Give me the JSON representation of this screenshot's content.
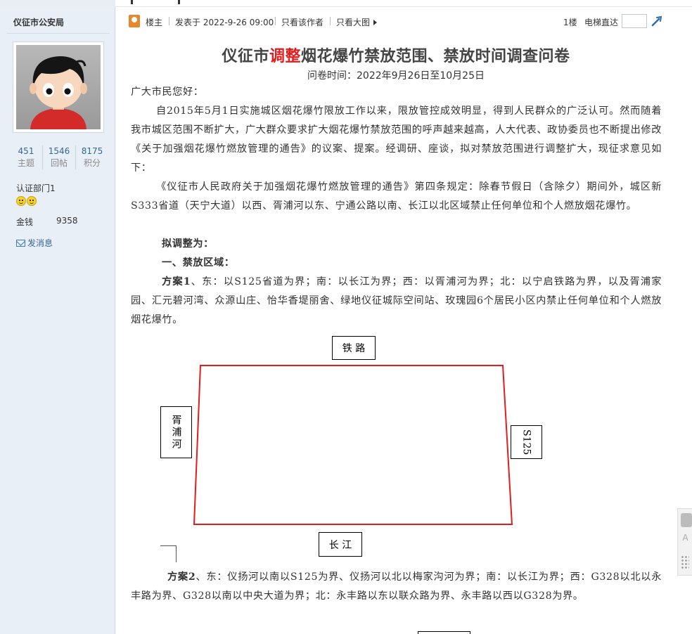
{
  "user": {
    "name": "仪征市公安局",
    "stats": [
      {
        "value": "451",
        "label": "主题"
      },
      {
        "value": "1546",
        "label": "回帖"
      },
      {
        "value": "8175",
        "label": "积分"
      }
    ],
    "certification": "认证部门1",
    "money_label": "金钱",
    "money_value": "9358",
    "message_link": "发消息"
  },
  "post_header": {
    "role": "楼主",
    "posted_at": "发表于 2022-9-26 09:00",
    "only_author": "只看该作者",
    "big_image": "只看大图",
    "floor": "1楼",
    "elevator": "电梯直达"
  },
  "article": {
    "title_pre": "仪征市",
    "title_red": "调整",
    "title_post": "烟花爆竹禁放范围、禁放时间调查问卷",
    "subtitle": "问卷时间：2022年9月26日至10月25日",
    "greeting": "广大市民您好：",
    "p1": "自2015年5月1日实施城区烟花爆竹限放工作以来，限放管控成效明显，得到人民群众的广泛认可。然而随着我市城区范围不断扩大，广大群众要求扩大烟花爆竹禁放范围的呼声越来越高，人大代表、政协委员也不断提出修改《关于加强烟花爆竹燃放管理的通告》的议案、提案。经调研、座谈，拟对禁放范围进行调整扩大，现征求意见如下：",
    "p2": "《仪征市人民政府关于加强烟花爆竹燃放管理的通告》第四条规定：除春节假日（含除夕）期间外，城区新S333省道（天宁大道）以西、胥浦河以东、宁通公路以南、长江以北区域禁止任何单位和个人燃放烟花爆竹。",
    "h1": "拟调整为：",
    "h2": "一、禁放区域：",
    "plan1_label": "方案1",
    "plan1_text": "、东：以S125省道为界；南：以长江为界；西：以胥浦河为界；北：以宁启铁路为界，以及胥浦家园、汇元碧河湾、众源山庄、怡华香堤丽舍、绿地仪征城际空间站、玫瑰园6个居民小区内禁止任何单位和个人燃放烟花爆竹。",
    "plan2_label": "方案2",
    "plan2_text": "、东：仪扬河以南以S125为界、仪扬河以北以梅家沟河为界；南：以长江为界；西：G328以北以永丰路为界、G328以南以中央大道为界；北：永丰路以东以联众路为界、永丰路以西以G328为界。"
  },
  "diagram": {
    "north": "铁 路",
    "west": "胥浦河",
    "east": "S125",
    "south": "长 江",
    "boundary_color": "#e31d1d"
  }
}
